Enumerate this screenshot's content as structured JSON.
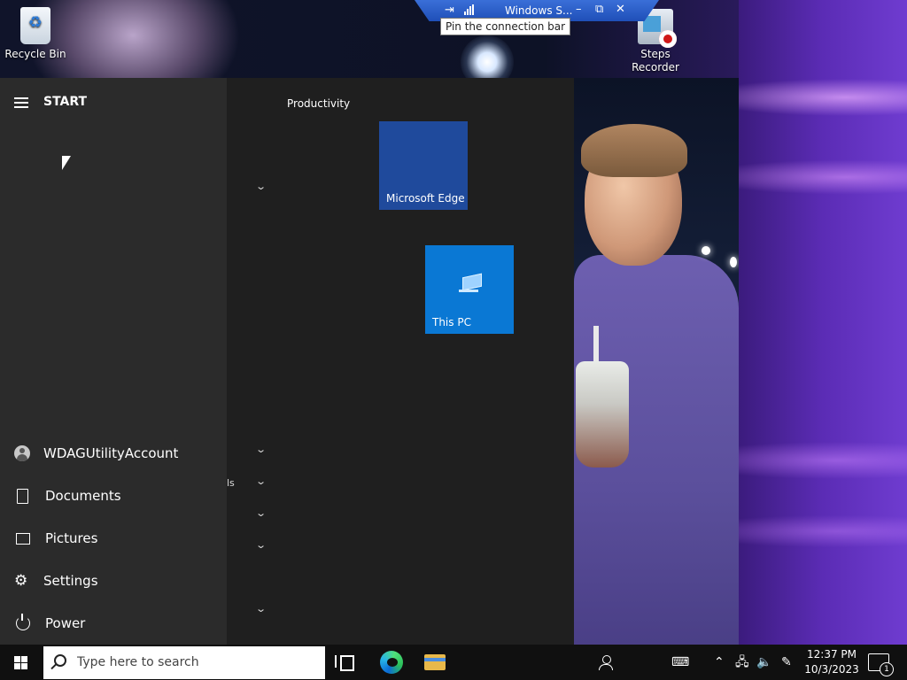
{
  "desktop": {
    "icons": [
      {
        "label": "Recycle Bin"
      },
      {
        "label": "Steps Recorder"
      }
    ]
  },
  "connection_bar": {
    "title": "Windows S...",
    "tooltip": "Pin the connection bar"
  },
  "start_menu": {
    "title": "START",
    "user": "WDAGUtilityAccount",
    "items": [
      {
        "label": "Documents"
      },
      {
        "label": "Pictures"
      },
      {
        "label": "Settings"
      },
      {
        "label": "Power"
      }
    ],
    "partial_text": "ls",
    "group_label": "Productivity",
    "tiles": [
      {
        "label": "Microsoft Edge"
      },
      {
        "label": "This PC"
      }
    ]
  },
  "taskbar": {
    "search_placeholder": "Type here to search",
    "time": "12:37 PM",
    "date": "10/3/2023",
    "notification_count": "1"
  },
  "icons": [
    "recycle-bin-icon",
    "steps-recorder-icon",
    "pin-icon",
    "signal-icon",
    "hamburger-icon",
    "user-avatar-icon",
    "document-icon",
    "picture-icon",
    "gear-icon",
    "power-icon",
    "this-pc-icon",
    "windows-logo-icon",
    "search-icon",
    "task-view-icon",
    "edge-icon",
    "file-explorer-icon",
    "people-icon",
    "keyboard-icon",
    "chevron-up-icon",
    "network-icon",
    "volume-icon",
    "pen-icon",
    "notification-icon"
  ]
}
